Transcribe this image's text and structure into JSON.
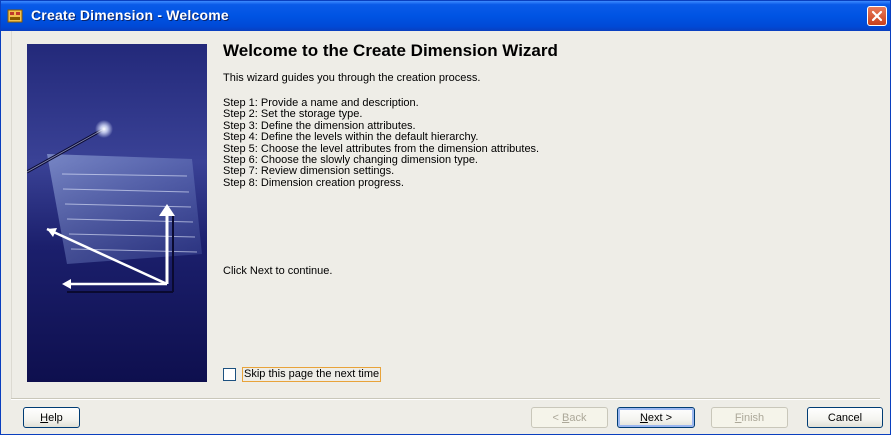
{
  "window": {
    "title": "Create Dimension - Welcome"
  },
  "main": {
    "heading": "Welcome to the Create Dimension Wizard",
    "intro": "This wizard guides you through the creation process.",
    "steps": [
      "Step 1: Provide a name and description.",
      "Step 2: Set the storage type.",
      "Step 3: Define the dimension attributes.",
      "Step 4: Define the levels within the default hierarchy.",
      "Step 5: Choose the level attributes from the dimension attributes.",
      "Step 6: Choose the slowly changing dimension type.",
      "Step 7: Review dimension settings.",
      "Step 8: Dimension creation progress."
    ],
    "continue_text": "Click Next to continue.",
    "skip_checkbox": {
      "label": "Skip this page the next time",
      "checked": false
    }
  },
  "buttons": {
    "help": {
      "mnemonic": "H",
      "rest": "elp"
    },
    "back": {
      "prefix": "< ",
      "mnemonic": "B",
      "rest": "ack"
    },
    "next": {
      "mnemonic": "N",
      "rest": "ext >"
    },
    "finish": {
      "mnemonic": "F",
      "rest": "inish"
    },
    "cancel": {
      "label": "Cancel"
    }
  },
  "colors": {
    "titlebar": "#0054e3",
    "side_image_bg": "#1a1d6e",
    "close_button": "#c9401b"
  }
}
